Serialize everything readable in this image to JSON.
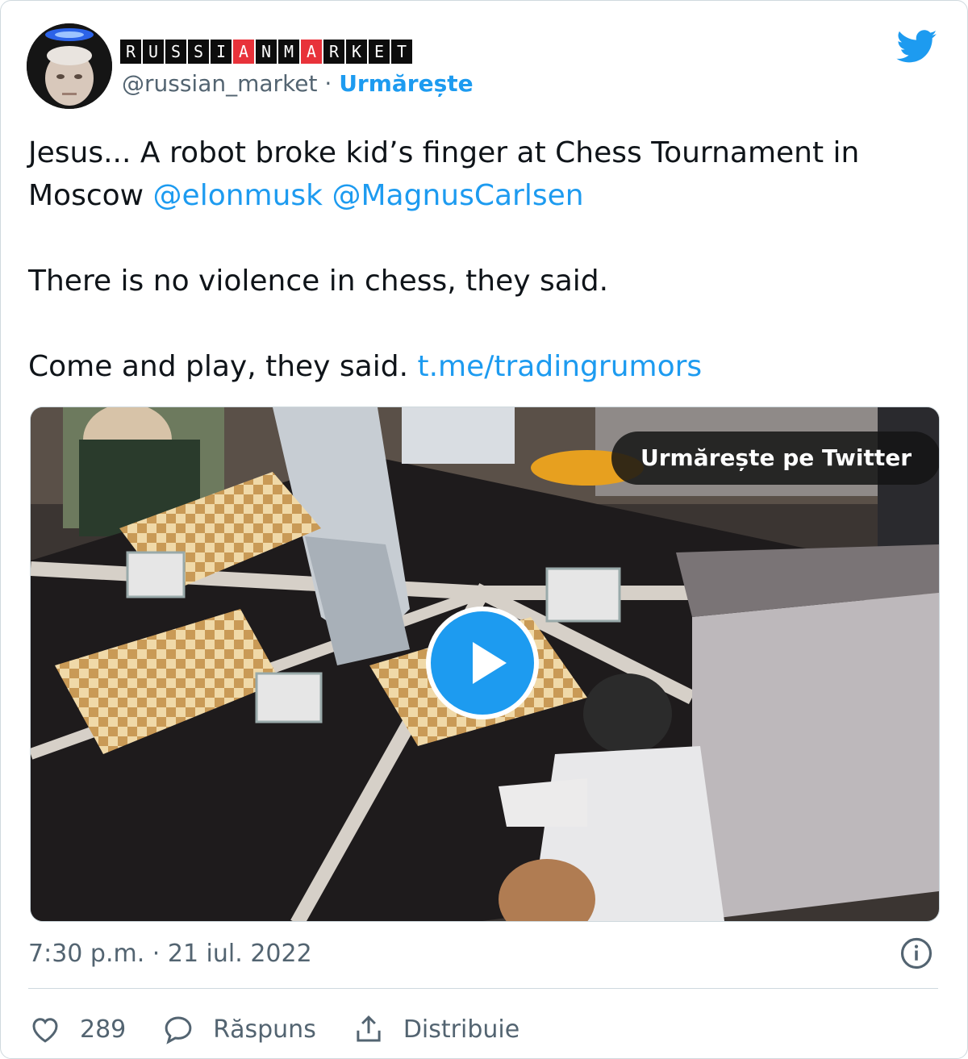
{
  "account": {
    "wordmark_letters": [
      "R",
      "U",
      "S",
      "S",
      "I",
      "A",
      "N",
      "M",
      "A",
      "R",
      "K",
      "E",
      "T"
    ],
    "wordmark_highlight_indices": [
      5,
      8
    ],
    "handle": "@russian_market",
    "separator": " · ",
    "follow_label": "Urmărește"
  },
  "tweet": {
    "line1_text": "Jesus... A robot broke kid’s finger at Chess Tournament in Moscow ",
    "mention1": "@elonmusk",
    "space": " ",
    "mention2": "@MagnusCarlsen",
    "line2": "There is no violence in chess, they said.",
    "line3_text": "Come and play, they said. ",
    "link": "t.me/tradingrumors"
  },
  "media": {
    "watch_label": "Urmărește pe Twitter"
  },
  "footer": {
    "timestamp": "7:30 p.m. · 21 iul. 2022",
    "likes": "289",
    "reply_label": "Răspuns",
    "share_label": "Distribuie"
  },
  "colors": {
    "accent": "#1d9bf0",
    "text": "#0f1419",
    "muted": "#536471",
    "wordmark_red": "#e8323a"
  },
  "icons": [
    "twitter-bird-icon",
    "play-icon",
    "info-icon",
    "heart-icon",
    "reply-bubble-icon",
    "share-icon"
  ]
}
